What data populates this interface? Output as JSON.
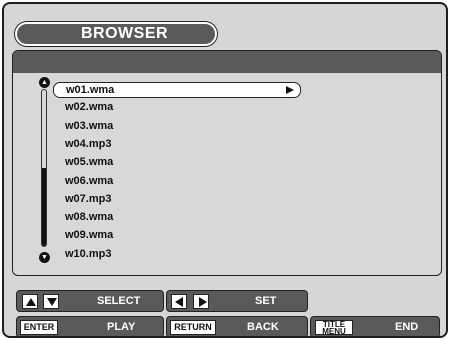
{
  "window": {
    "title": "BROWSER"
  },
  "file_list": {
    "items": [
      {
        "name": "w01.wma",
        "selected": true
      },
      {
        "name": "w02.wma",
        "selected": false
      },
      {
        "name": "w03.wma",
        "selected": false
      },
      {
        "name": "w04.mp3",
        "selected": false
      },
      {
        "name": "w05.wma",
        "selected": false
      },
      {
        "name": "w06.wma",
        "selected": false
      },
      {
        "name": "w07.mp3",
        "selected": false
      },
      {
        "name": "w08.wma",
        "selected": false
      },
      {
        "name": "w09.wma",
        "selected": false
      },
      {
        "name": "w10.mp3",
        "selected": false
      }
    ],
    "scroll_position": 0.5
  },
  "controls": {
    "select": {
      "label": "SELECT",
      "icons": [
        "up-arrow-icon",
        "down-arrow-icon"
      ]
    },
    "set": {
      "label": "SET",
      "icons": [
        "left-arrow-icon",
        "right-arrow-icon"
      ]
    },
    "play": {
      "key": "ENTER",
      "label": "PLAY"
    },
    "back": {
      "key": "RETURN",
      "label": "BACK"
    },
    "end": {
      "key_line1": "TITLE",
      "key_line2": "MENU",
      "label": "END"
    }
  },
  "colors": {
    "header": "#5a5a5a",
    "panel": "#d8d8d8",
    "highlight": "#ffffff"
  }
}
